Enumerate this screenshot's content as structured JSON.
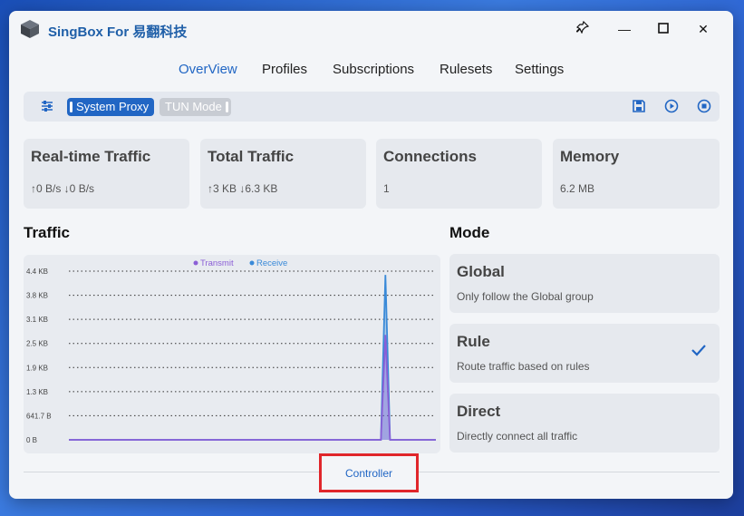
{
  "window": {
    "title": "SingBox For 易翻科技"
  },
  "titlebar": {
    "pin_glyph": "⊥",
    "minimize_glyph": "—",
    "maximize_glyph": "☐",
    "close_glyph": "✕"
  },
  "nav": {
    "tabs": [
      {
        "label": "OverView",
        "active": true
      },
      {
        "label": "Profiles"
      },
      {
        "label": "Subscriptions"
      },
      {
        "label": "Rulesets"
      },
      {
        "label": "Settings"
      }
    ]
  },
  "toolbar": {
    "system_proxy_label": "System Proxy",
    "system_proxy_on": true,
    "tun_mode_label": "TUN Mode",
    "tun_mode_on": false
  },
  "cards": [
    {
      "title": "Real-time Traffic",
      "value": "↑0 B/s ↓0 B/s"
    },
    {
      "title": "Total Traffic",
      "value": "↑3 KB ↓6.3 KB"
    },
    {
      "title": "Connections",
      "value": "1"
    },
    {
      "title": "Memory",
      "value": "6.2 MB"
    }
  ],
  "traffic": {
    "title": "Traffic",
    "chart_data": {
      "type": "area",
      "legend": [
        "Transmit",
        "Receive"
      ],
      "legend_placement": "top-center",
      "y_ticks": [
        "4.4 KB",
        "3.8 KB",
        "3.1 KB",
        "2.5 KB",
        "1.9 KB",
        "1.3 KB",
        "641.7 B",
        "0 B"
      ],
      "ylim": [
        0,
        4500
      ],
      "series": [
        {
          "name": "Transmit",
          "color": "#8b5fd6",
          "values": [
            0,
            0,
            0,
            0,
            0,
            0,
            0,
            0,
            0,
            0,
            0,
            0,
            0,
            0,
            0,
            0,
            0,
            0,
            0,
            0,
            0,
            0,
            0,
            0,
            0,
            0,
            0,
            0,
            0,
            0,
            0,
            0,
            0,
            0,
            0,
            0,
            0,
            0,
            0,
            0,
            0,
            0,
            0,
            0,
            0,
            0,
            0,
            0,
            0,
            0,
            0,
            0,
            0,
            0,
            0,
            0,
            0,
            0,
            0,
            0,
            0,
            0,
            0,
            0,
            0,
            0,
            0,
            0,
            0,
            2800,
            0,
            0,
            0,
            0,
            0,
            0,
            0,
            0,
            0,
            0,
            0
          ]
        },
        {
          "name": "Receive",
          "color": "#3a8ad8",
          "values": [
            0,
            0,
            0,
            0,
            0,
            0,
            0,
            0,
            0,
            0,
            0,
            0,
            0,
            0,
            0,
            0,
            0,
            0,
            0,
            0,
            0,
            0,
            0,
            0,
            0,
            0,
            0,
            0,
            0,
            0,
            0,
            0,
            0,
            0,
            0,
            0,
            0,
            0,
            0,
            0,
            0,
            0,
            0,
            0,
            0,
            0,
            0,
            0,
            0,
            0,
            0,
            0,
            0,
            0,
            0,
            0,
            0,
            0,
            0,
            0,
            0,
            0,
            0,
            0,
            0,
            0,
            0,
            0,
            0,
            4400,
            0,
            0,
            0,
            0,
            0,
            0,
            0,
            0,
            0,
            0,
            0
          ]
        }
      ],
      "grid": true
    }
  },
  "mode": {
    "title": "Mode",
    "items": [
      {
        "title": "Global",
        "desc": "Only follow the Global group",
        "selected": false
      },
      {
        "title": "Rule",
        "desc": "Route traffic based on rules",
        "selected": true
      },
      {
        "title": "Direct",
        "desc": "Directly connect all traffic",
        "selected": false
      }
    ]
  },
  "footer": {
    "controller_label": "Controller"
  },
  "colors": {
    "accent": "#2166c4",
    "highlight": "#e0262b"
  }
}
